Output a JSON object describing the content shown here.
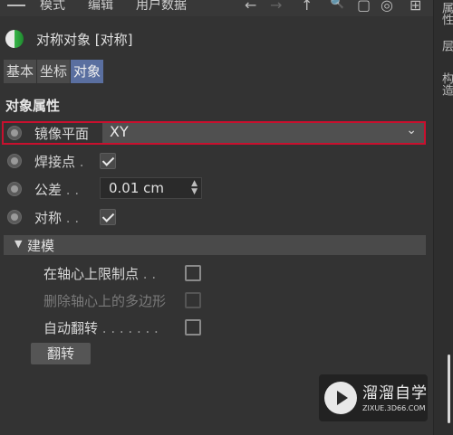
{
  "menubar": {
    "items": [
      "模式",
      "编辑",
      "用户数据"
    ],
    "tools": [
      "←",
      "→",
      "↑",
      "🔍",
      "▢",
      "◎",
      "⊞"
    ]
  },
  "side_tabs": [
    "属性",
    "层",
    "构造"
  ],
  "object": {
    "title": "对称对象 [对称]",
    "icon": "symmetry-object-icon"
  },
  "tabs": [
    {
      "label": "基本",
      "active": false
    },
    {
      "label": "坐标",
      "active": false
    },
    {
      "label": "对象",
      "active": true
    }
  ],
  "section_title": "对象属性",
  "properties": {
    "mirror_plane": {
      "label": "镜像平面",
      "value": "XY"
    },
    "weld_points": {
      "label": "焊接点",
      "dots": ".",
      "checked": true
    },
    "tolerance": {
      "label": "公差",
      "dots": ". .",
      "value": "0.01 cm"
    },
    "symmetry": {
      "label": "对称",
      "dots": ". .",
      "checked": true
    }
  },
  "modeling_group": {
    "title": "建模",
    "items": [
      {
        "label": "在轴心上限制点",
        "dots": ". .",
        "checked": false,
        "disabled": false
      },
      {
        "label": "删除轴心上的多边形",
        "dots": "",
        "checked": false,
        "disabled": true
      },
      {
        "label": "自动翻转",
        "dots": ". . . . . . .",
        "checked": false,
        "disabled": false
      }
    ],
    "flip_button": "翻转"
  },
  "watermark": {
    "title": "溜溜自学",
    "url": "ZIXUE.3D66.COM"
  },
  "colors": {
    "accent_tab": "#5a6fa0",
    "highlight_border": "#c8102e",
    "background": "#333333"
  }
}
